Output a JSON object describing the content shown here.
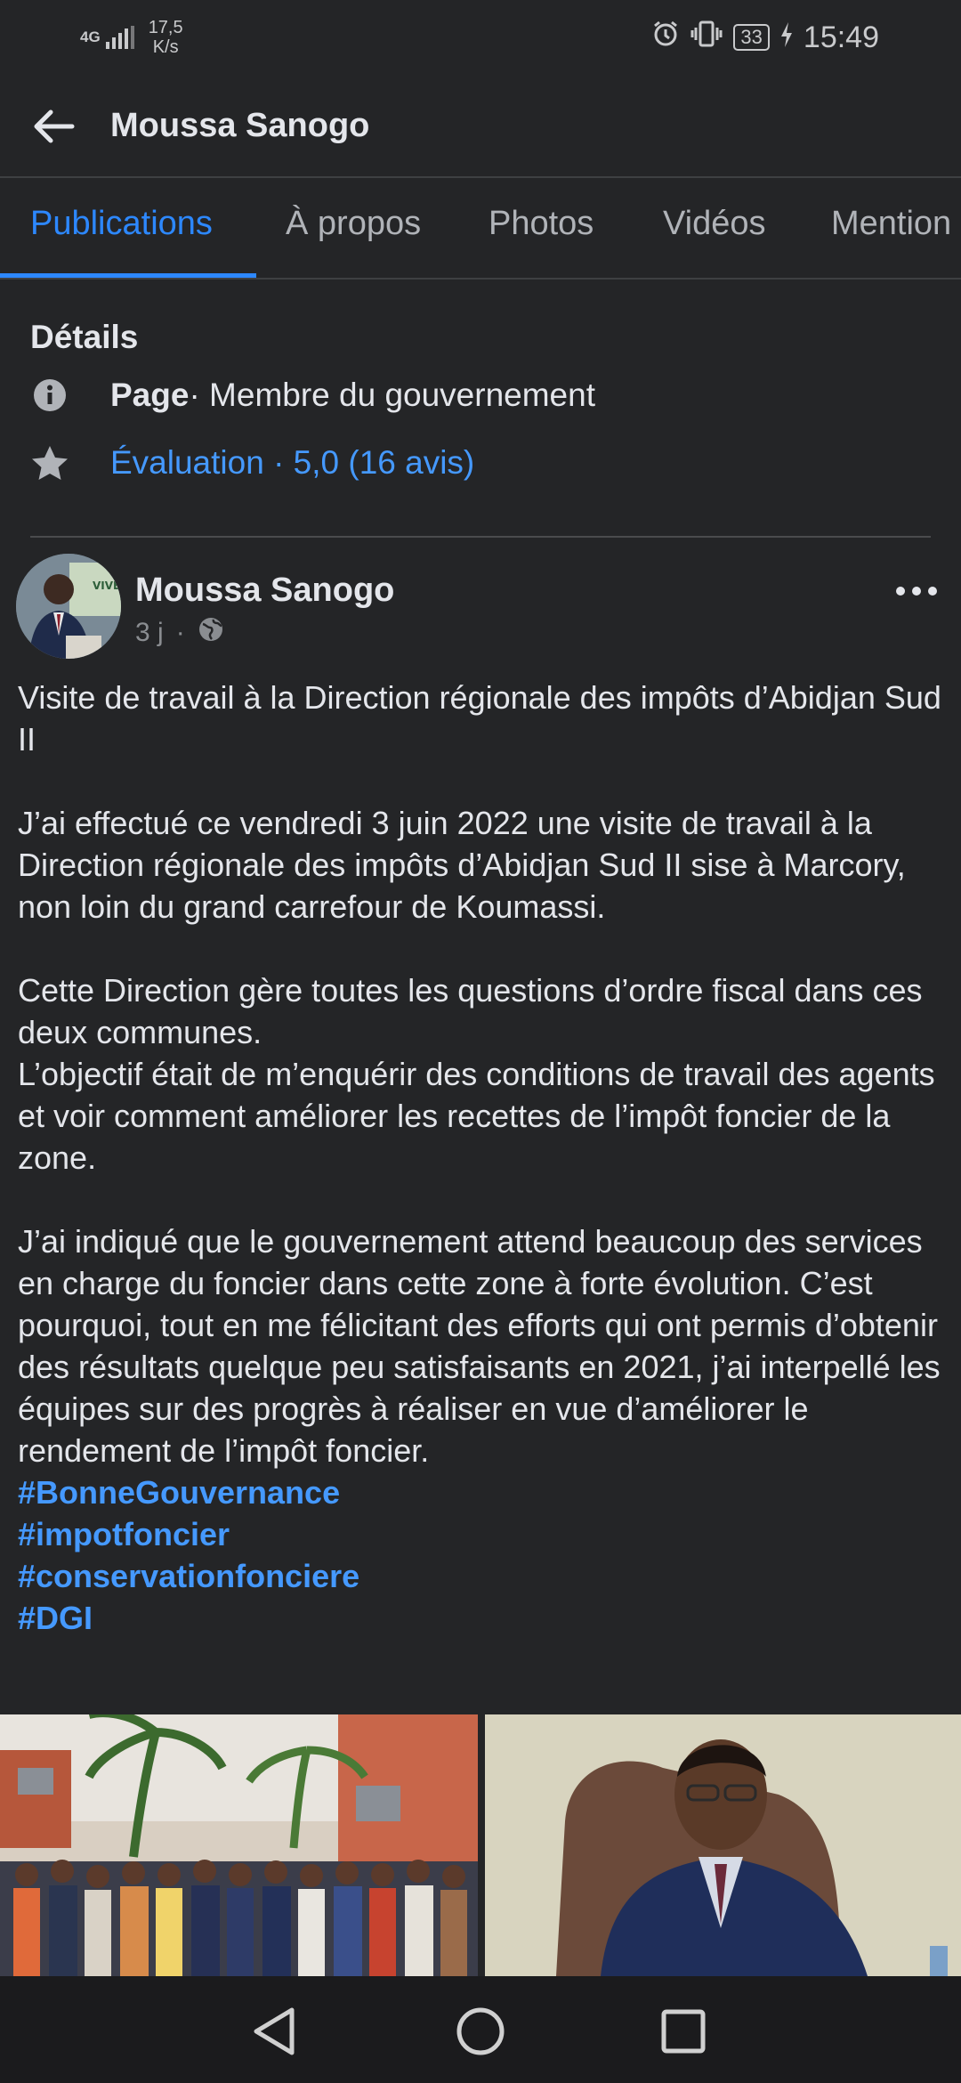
{
  "status_bar": {
    "network": "4G",
    "speed_value": "17,5",
    "speed_unit": "K/s",
    "battery": "33",
    "time": "15:49"
  },
  "header": {
    "title": "Moussa Sanogo"
  },
  "tabs": [
    "Publications",
    "À propos",
    "Photos",
    "Vidéos",
    "Mention"
  ],
  "details": {
    "title": "Détails",
    "page_label": "Page",
    "page_category": " · Membre du gouvernement",
    "rating": "Évaluation · 5,0 (16 avis)"
  },
  "post": {
    "author": "Moussa Sanogo",
    "time": "3 j",
    "paragraphs": [
      "Visite de travail à la Direction régionale des impôts d’Abidjan Sud II",
      "J’ai effectué ce vendredi 3 juin 2022 une visite de travail à la Direction régionale des impôts d’Abidjan Sud II sise à Marcory, non loin du grand carrefour de Koumassi.",
      "Cette Direction gère toutes les questions d’ordre fiscal dans ces deux communes.\nL’objectif était de m’enquérir des conditions de travail des agents et voir comment améliorer les recettes de l’impôt foncier de la zone.",
      "J’ai indiqué que le gouvernement attend beaucoup des services en charge du foncier dans cette zone à forte évolution. C’est pourquoi, tout en me félicitant des efforts qui ont permis d’obtenir des résultats quelque peu satisfaisants en 2021, j’ai interpellé les équipes sur des progrès à réaliser en vue d’améliorer le rendement de l’impôt foncier."
    ],
    "hashtags": [
      "#BonneGouvernance",
      "#impotfoncier",
      "#conservationfonciere",
      "#DGI"
    ]
  },
  "icons": {
    "back": "arrow-left-icon",
    "info": "info-icon",
    "star": "star-icon",
    "globe": "globe-icon",
    "more": "more-dots-icon"
  },
  "colors": {
    "background": "#242527",
    "accent": "#2d88ff",
    "link": "#4599ff",
    "text": "#e4e6eb",
    "muted": "#b0b3b8"
  }
}
